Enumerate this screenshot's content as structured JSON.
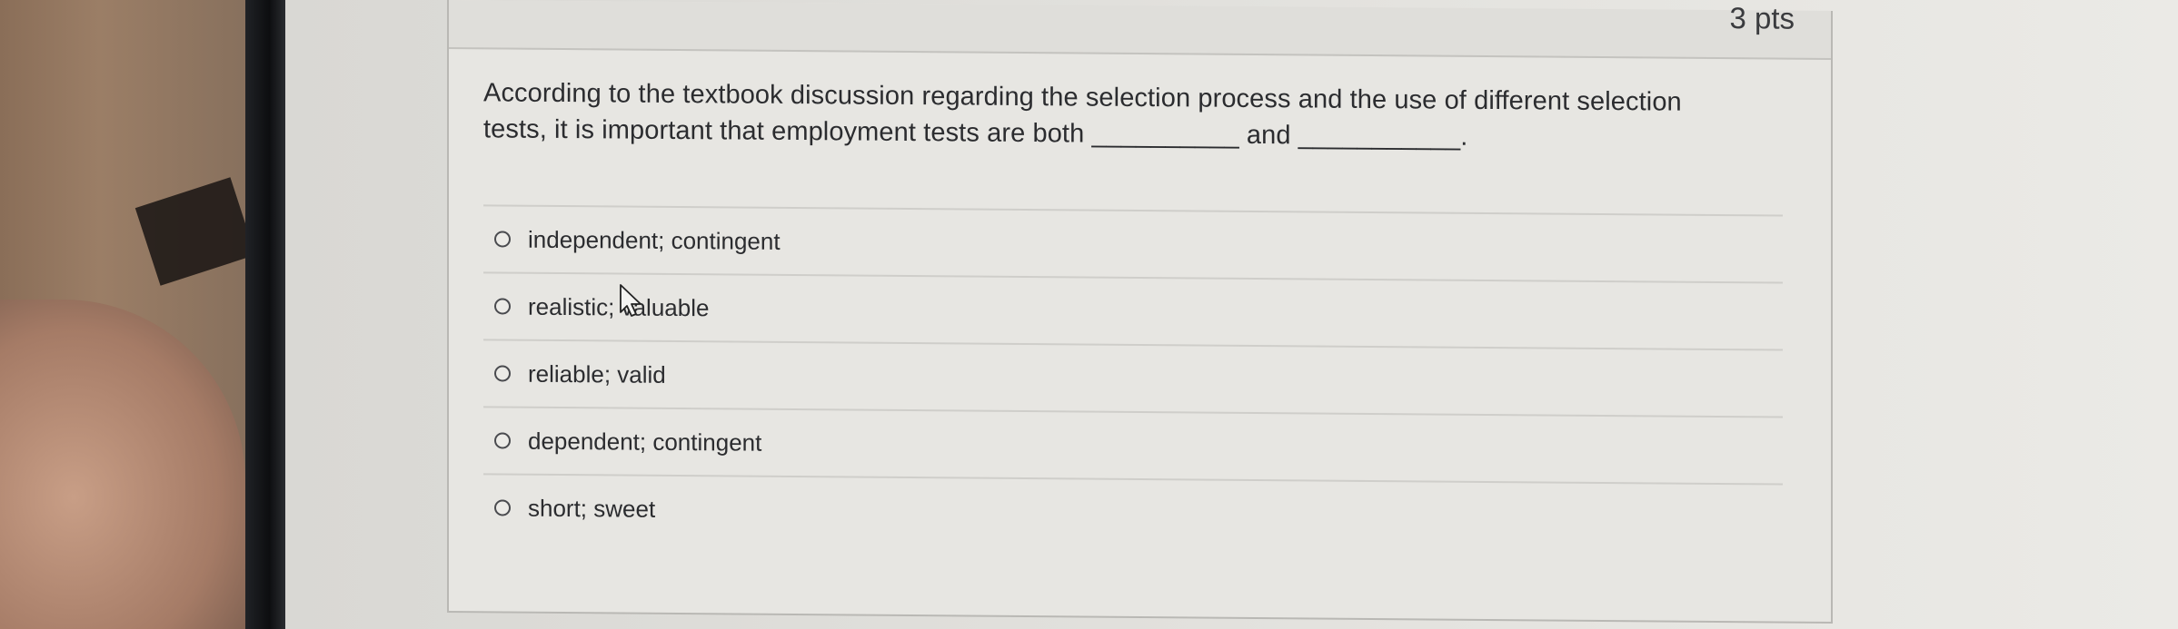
{
  "question": {
    "points": "3 pts",
    "line1": "According to the textbook discussion regarding the selection process and the use of different selection",
    "line2": "tests, it is important that employment tests are both __________ and ___________.",
    "options": [
      {
        "label": "independent; contingent"
      },
      {
        "label": "realistic; valuable"
      },
      {
        "label": "reliable; valid"
      },
      {
        "label": "dependent; contingent"
      },
      {
        "label": "short; sweet"
      }
    ]
  },
  "colors": {
    "card_background": "#e7e6e2",
    "text": "#2b2c2f",
    "border": "#b9b8b4"
  },
  "icons": {
    "radio": "radio-unselected-icon",
    "cursor": "mouse-pointer-icon"
  }
}
